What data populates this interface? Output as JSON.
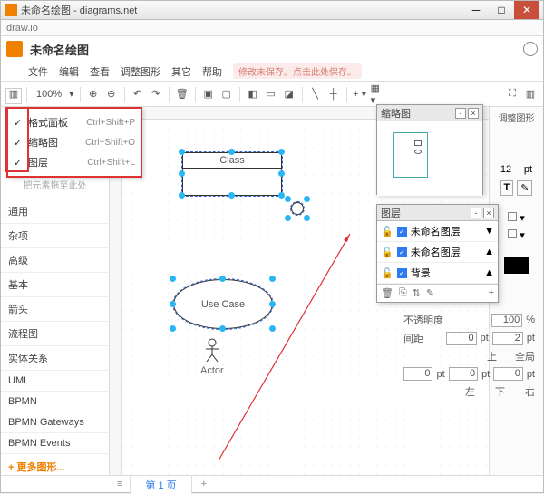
{
  "window": {
    "title": "未命名绘图 - diagrams.net",
    "addr": "draw.io"
  },
  "app": {
    "doc_title": "未命名绘图"
  },
  "menu": {
    "items": [
      "文件",
      "编辑",
      "查看",
      "调整图形",
      "其它",
      "帮助"
    ],
    "save_hint": "修改未保存。点击此处保存。"
  },
  "toolbar": {
    "zoom": "100%"
  },
  "viewmenu": {
    "items": [
      {
        "label": "格式面板",
        "shortcut": "Ctrl+Shift+P"
      },
      {
        "label": "缩略图",
        "shortcut": "Ctrl+Shift+O"
      },
      {
        "label": "图层",
        "shortcut": "Ctrl+Shift+L"
      }
    ]
  },
  "sidebar": {
    "drag_prompt": "把元素拖至此处",
    "categories": [
      "通用",
      "杂项",
      "高级",
      "基本",
      "箭头",
      "流程图",
      "实体关系",
      "UML",
      "BPMN",
      "BPMN Gateways",
      "BPMN Events"
    ],
    "more": "+ 更多图形..."
  },
  "shapes": {
    "class_label": "Class",
    "usecase_label": "Use Case",
    "actor_label": "Actor"
  },
  "right": {
    "format_label": "调整图形",
    "size_val": "12",
    "size_unit": "pt"
  },
  "outline": {
    "title": "缩略图"
  },
  "layers": {
    "title": "图层",
    "items": [
      "未命名图层",
      "未命名图层",
      "背景"
    ]
  },
  "props": {
    "opacity_label": "不透明度",
    "opacity_val": "100",
    "pct": "%",
    "spacing_label": "间距",
    "sp_top": "0",
    "sp_right": "2",
    "pos_top": "上",
    "pos_global": "全局",
    "sp_left": "0",
    "sp_bottom": "0",
    "sp_r2": "0",
    "pos_left": "左",
    "pos_bot": "下",
    "pos_right": "右",
    "pt": "pt"
  },
  "footer": {
    "tab": "第 1 页",
    "add": "+"
  }
}
